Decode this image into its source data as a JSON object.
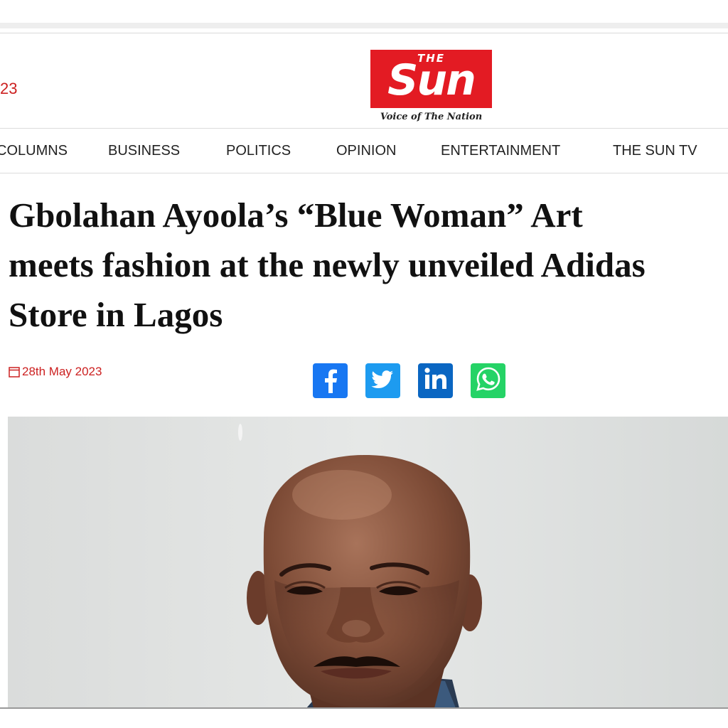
{
  "header": {
    "date_fragment": "23",
    "logo": {
      "small_text": "THE",
      "main_text": "Sun",
      "tagline": "Voice of The Nation",
      "color": "#e31b23"
    }
  },
  "nav": {
    "items": [
      {
        "label": "COLUMNS"
      },
      {
        "label": "BUSINESS"
      },
      {
        "label": "POLITICS"
      },
      {
        "label": "OPINION"
      },
      {
        "label": "ENTERTAINMENT"
      },
      {
        "label": "THE SUN TV"
      }
    ]
  },
  "article": {
    "headline_lines": [
      "Gbolahan Ayoola’s “Blue Woman” Art",
      "meets fashion at the newly unveiled Adidas",
      "Store in Lagos"
    ],
    "date": "28th May 2023",
    "date_icon": "calendar-icon",
    "share": [
      {
        "name": "facebook",
        "icon": "facebook-icon",
        "color": "#1877f2"
      },
      {
        "name": "twitter",
        "icon": "twitter-icon",
        "color": "#1d9bf0"
      },
      {
        "name": "linkedin",
        "icon": "linkedin-icon",
        "color": "#0a66c2"
      },
      {
        "name": "whatsapp",
        "icon": "whatsapp-icon",
        "color": "#25d366"
      }
    ],
    "photo": {
      "subject": "portrait-photo"
    }
  },
  "colors": {
    "accent_red": "#cc2020",
    "text": "#111111"
  }
}
